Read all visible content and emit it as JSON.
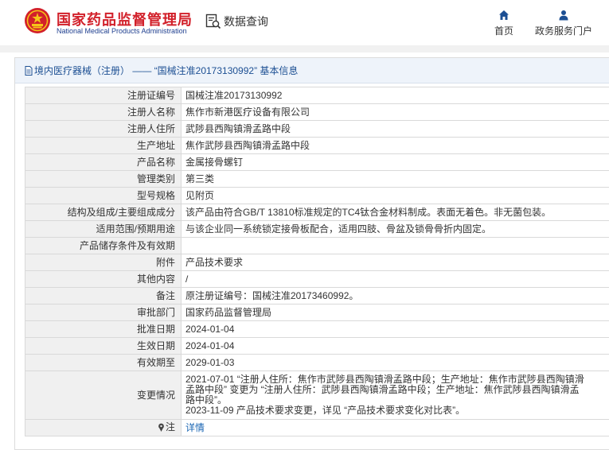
{
  "header": {
    "brand_cn": "国家药品监督管理局",
    "brand_en": "National Medical Products Administration",
    "data_query": "数据查询",
    "nav": [
      {
        "label": "首页",
        "icon": "home-icon"
      },
      {
        "label": "政务服务门户",
        "icon": "user-icon"
      }
    ],
    "colors": {
      "brand_red": "#d2202a",
      "brand_blue": "#1f3f8f",
      "nav_blue": "#1c4f93"
    }
  },
  "breadcrumb": {
    "text": "境内医疗器械（注册） —— “国械注准20173130992” 基本信息"
  },
  "rows": [
    {
      "label": "注册证编号",
      "value": "国械注准20173130992"
    },
    {
      "label": "注册人名称",
      "value": "焦作市新港医疗设备有限公司"
    },
    {
      "label": "注册人住所",
      "value": "武陟县西陶镇滑孟路中段"
    },
    {
      "label": "生产地址",
      "value": "焦作武陟县西陶镇滑孟路中段"
    },
    {
      "label": "产品名称",
      "value": "金属接骨螺钉"
    },
    {
      "label": "管理类别",
      "value": "第三类"
    },
    {
      "label": "型号规格",
      "value": "见附页"
    },
    {
      "label": "结构及组成/主要组成成分",
      "value": "该产品由符合GB/T 13810标准规定的TC4钛合金材料制成。表面无着色。非无菌包装。"
    },
    {
      "label": "适用范围/预期用途",
      "value": "与该企业同一系统锁定接骨板配合，适用四肢、骨盆及锁骨骨折内固定。"
    },
    {
      "label": "产品储存条件及有效期",
      "value": ""
    },
    {
      "label": "附件",
      "value": "产品技术要求"
    },
    {
      "label": "其他内容",
      "value": "/"
    },
    {
      "label": "备注",
      "value": "原注册证编号：国械注准20173460992。"
    },
    {
      "label": "审批部门",
      "value": "国家药品监督管理局"
    },
    {
      "label": "批准日期",
      "value": "2024-01-04"
    },
    {
      "label": "生效日期",
      "value": "2024-01-04"
    },
    {
      "label": "有效期至",
      "value": "2029-01-03"
    }
  ],
  "changes": {
    "label": "变更情况",
    "lines": [
      "2021-07-01 “注册人住所：焦作市武陟县西陶镇滑孟路中段；生产地址：焦作市武陟县西陶镇滑",
      "孟路中段” 变更为 “注册人住所：武陟县西陶镇滑孟路中段；生产地址：焦作武陟县西陶镇滑孟",
      "路中段”。",
      "2023-11-09 产品技术要求变更，详见 “产品技术要求变化对比表”。"
    ]
  },
  "note": {
    "label": "注",
    "icon": "pin-icon",
    "value": "详情"
  }
}
